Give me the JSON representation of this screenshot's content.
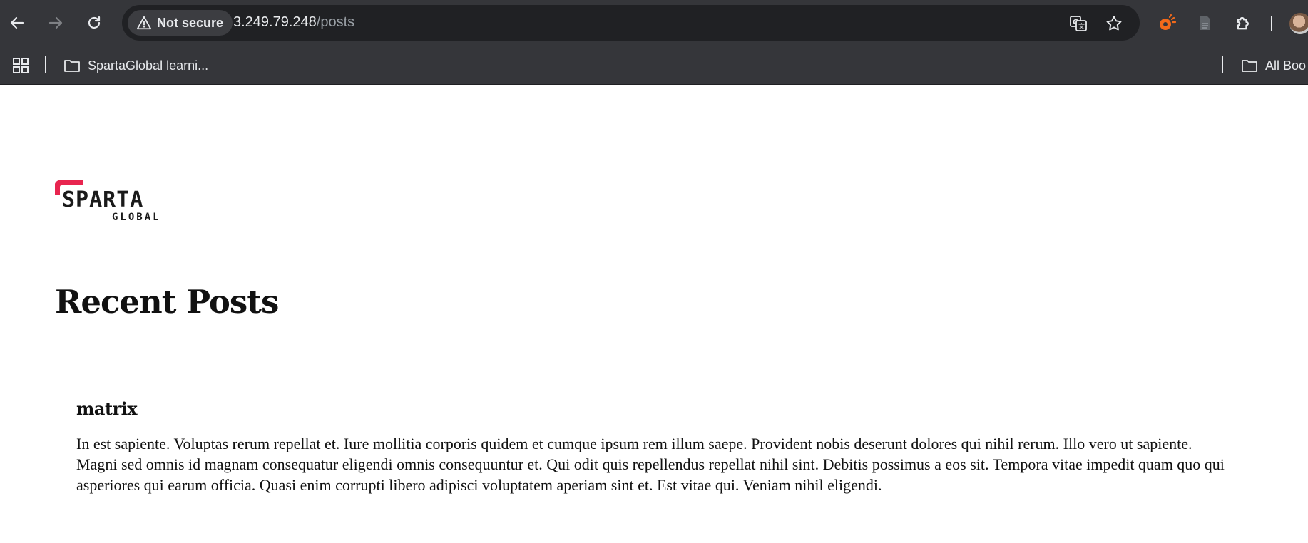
{
  "browser": {
    "security_label": "Not secure",
    "url_host": "3.249.79.248",
    "url_path": "/posts",
    "bookmarks": {
      "items": [
        {
          "label": "SpartaGlobal learni..."
        }
      ],
      "all_bookmarks_label": "All Boo"
    },
    "icons": [
      "back-arrow-icon",
      "forward-arrow-icon",
      "reload-icon",
      "warning-triangle-icon",
      "translate-icon",
      "star-icon",
      "extension-icon",
      "puzzle-icon",
      "apps-grid-icon",
      "folder-icon"
    ]
  },
  "page": {
    "logo_text_main": "SPARTA",
    "logo_text_sub": "GLOBAL",
    "logo_accent_color": "#e8254f",
    "heading": "Recent Posts",
    "posts": [
      {
        "title": "matrix",
        "body": "In est sapiente. Voluptas rerum repellat et. Iure mollitia corporis quidem et cumque ipsum rem illum saepe. Provident nobis deserunt dolores qui nihil rerum. Illo vero ut sapiente. Magni sed omnis id magnam consequatur eligendi omnis consequuntur et. Qui odit quis repellendus repellat nihil sint. Debitis possimus a eos sit. Tempora vitae impedit quam quo qui asperiores qui earum officia. Quasi enim corrupti libero adipisci voluptatem aperiam sint et. Est vitae qui. Veniam nihil eligendi."
      }
    ]
  }
}
